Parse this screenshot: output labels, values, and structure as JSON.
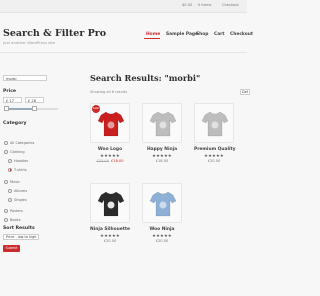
{
  "topbar": {
    "cart": "$0.00",
    "items": "0 items",
    "checkout": "Checkout"
  },
  "brand": {
    "title": "Search & Filter Pro",
    "subtitle": "just another WordPress site"
  },
  "nav": {
    "items": [
      "Home",
      "Sample Page",
      "Shop",
      "Cart",
      "Checkout"
    ],
    "active": "Home",
    "accent": "#cc2b2b"
  },
  "sidebar": {
    "search_value": "morbi",
    "price_heading": "Price",
    "price_min": "£ 17",
    "price_max": "£ 26",
    "category_heading": "Category",
    "categories": [
      {
        "label": "All Categories",
        "checked": false
      },
      {
        "label": "Clothing",
        "checked": false
      },
      {
        "label": "Hoodies",
        "checked": false
      },
      {
        "label": "T-shirts",
        "checked": true
      },
      {
        "label": "Music",
        "checked": false
      },
      {
        "label": "Albums",
        "checked": false
      },
      {
        "label": "Singles",
        "checked": false
      },
      {
        "label": "Posters",
        "checked": false
      },
      {
        "label": "Books",
        "checked": false
      }
    ],
    "sort_heading": "Sort Results",
    "sort_value": "Price - low to high",
    "submit_label": "Submit"
  },
  "results": {
    "title": "Search Results: \"morbi\"",
    "showing": "Showing all 6 results",
    "sort_value": "Def",
    "products": [
      {
        "name": "Woo Logo",
        "stars": "★★★★★",
        "old_price": "£35.00",
        "price": "£18.00",
        "sale": "Sale!",
        "shirt_color": "#c9201f",
        "variant": "tee"
      },
      {
        "name": "Happy Ninja",
        "stars": "★★★★★",
        "old_price": "",
        "price": "£18.00",
        "sale": "",
        "shirt_color": "#bdbdbd",
        "variant": "tee"
      },
      {
        "name": "Premium Quality",
        "stars": "★★★★★",
        "old_price": "",
        "price": "£20.00",
        "sale": "",
        "shirt_color": "#bdbdbd",
        "variant": "tee"
      },
      {
        "name": "Ninja Silhouette",
        "stars": "★★★★★",
        "old_price": "",
        "price": "£20.00",
        "sale": "",
        "shirt_color": "#2b2b2b",
        "variant": "tee"
      },
      {
        "name": "Woo Ninja",
        "stars": "★★★★★",
        "old_price": "",
        "price": "£20.00",
        "sale": "",
        "shirt_color": "#8fb0d6",
        "variant": "tee"
      }
    ]
  }
}
